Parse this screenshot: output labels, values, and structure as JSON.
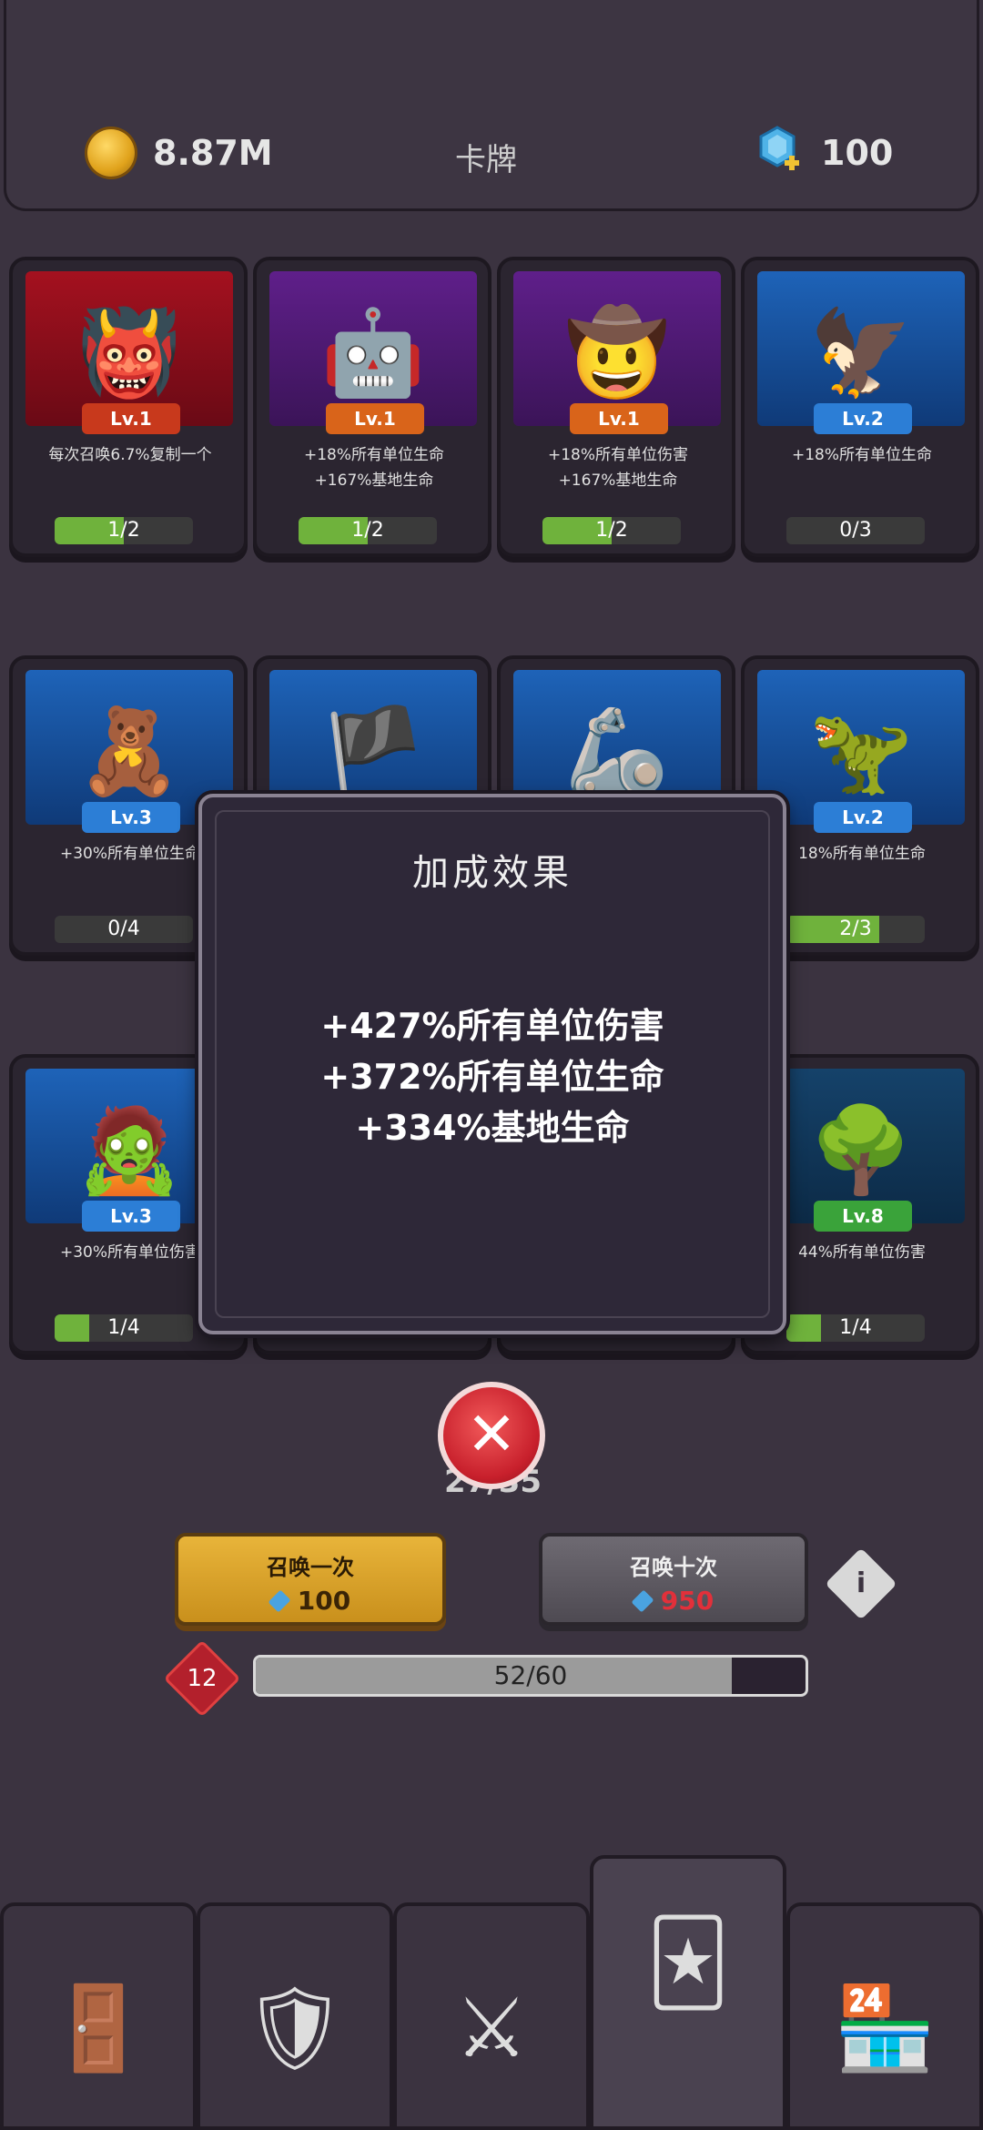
{
  "header": {
    "coins": "8.87M",
    "title": "卡牌",
    "gems": "100",
    "coin_icon": "gold-coin-icon",
    "gem_icon": "gem-plus-icon"
  },
  "cards": [
    {
      "level": "Lv.1",
      "desc": "每次召唤6.7%复制一个",
      "progress": "1/2",
      "fill": 0.5,
      "art": "red",
      "lvcolor": "red"
    },
    {
      "level": "Lv.1",
      "desc": "+18%所有单位生命\n+167%基地生命",
      "progress": "1/2",
      "fill": 0.5,
      "art": "purple",
      "lvcolor": "orange"
    },
    {
      "level": "Lv.1",
      "desc": "+18%所有单位伤害\n+167%基地生命",
      "progress": "1/2",
      "fill": 0.5,
      "art": "purple",
      "lvcolor": "orange"
    },
    {
      "level": "Lv.2",
      "desc": "+18%所有单位生命",
      "progress": "0/3",
      "fill": 0.0,
      "art": "blue",
      "lvcolor": "blue"
    },
    {
      "level": "Lv.3",
      "desc": "+30%所有单位生命",
      "progress": "0/4",
      "fill": 0.0,
      "art": "blue",
      "lvcolor": "blue"
    },
    {
      "level": "Lv.2",
      "desc": "18%所有单位生命",
      "progress": "2/3",
      "fill": 0.67,
      "art": "blue",
      "lvcolor": "blue"
    },
    {
      "level": "Lv.3",
      "desc": "+30%所有单位伤害",
      "progress": "1/4",
      "fill": 0.25,
      "art": "blue",
      "lvcolor": "blue"
    },
    {
      "level": "Lv.8",
      "desc": "44%所有单位伤害",
      "progress": "1/4",
      "fill": 0.25,
      "art": "teal",
      "lvcolor": "green"
    }
  ],
  "popup": {
    "title": "加成效果",
    "effects": [
      "+427%所有单位伤害",
      "+372%所有单位生命",
      "+334%基地生命"
    ]
  },
  "summon_count": "27/35",
  "summon_once": {
    "label": "召唤一次",
    "cost": "100"
  },
  "summon_ten": {
    "label": "召唤十次",
    "cost": "950"
  },
  "player_level": "12",
  "xp": {
    "text": "52/60",
    "fill": 0.8667
  },
  "nav_tabs": [
    {
      "name": "dungeon-gate-icon",
      "glyph": "🚪"
    },
    {
      "name": "winged-shield-icon",
      "glyph": "🛡"
    },
    {
      "name": "crossed-swords-icon",
      "glyph": "⚔"
    },
    {
      "name": "skull-cards-icon",
      "glyph": "🃏"
    },
    {
      "name": "shop-icon",
      "glyph": "🏪"
    }
  ]
}
